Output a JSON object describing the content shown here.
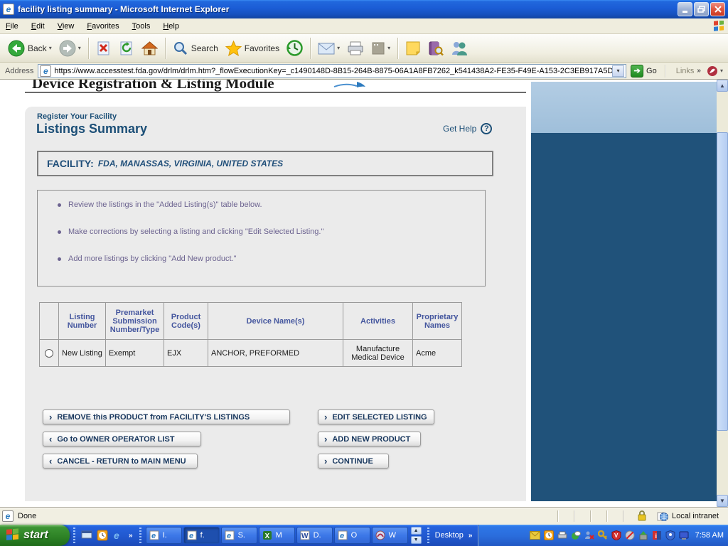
{
  "window": {
    "title": "facility listing summary - Microsoft Internet Explorer"
  },
  "menu": {
    "items": [
      "File",
      "Edit",
      "View",
      "Favorites",
      "Tools",
      "Help"
    ]
  },
  "toolbar": {
    "back_label": "Back",
    "search_label": "Search",
    "favorites_label": "Favorites"
  },
  "address": {
    "label": "Address",
    "url": "https://www.accesstest.fda.gov/drlm/drlm.htm?_flowExecutionKey=_c1490148D-8B15-264B-8875-06A1A8FB7262_k541438A2-FE35-F49E-A153-2C3EB917A5D",
    "go_label": "Go",
    "links_label": "Links"
  },
  "page": {
    "app_header": "Device Registration & Listing Module",
    "breadcrumb": "Register Your Facility",
    "title": "Listings Summary",
    "get_help": "Get Help",
    "facility_label": "FACILITY:",
    "facility_value": "FDA, MANASSAS, VIRGINIA, UNITED STATES",
    "instructions": [
      "Review the listings in the \"Added Listing(s)\" table below.",
      "Make corrections by selecting a listing and clicking \"Edit Selected Listing.\"",
      "Add more listings by clicking \"Add New product.\""
    ],
    "table": {
      "headers": [
        "Listing Number",
        "Premarket Submission Number/Type",
        "Product Code(s)",
        "Device Name(s)",
        "Activities",
        "Proprietary Names"
      ],
      "rows": [
        {
          "listing_number": "New Listing",
          "premarket": "Exempt",
          "product_code": "EJX",
          "device_names": "ANCHOR, PREFORMED",
          "activities": "Manufacture Medical Device",
          "proprietary": "Acme"
        }
      ]
    },
    "buttons": {
      "remove": "REMOVE this PRODUCT from FACILITY'S LISTINGS",
      "edit": "EDIT SELECTED LISTING",
      "owner": "Go to OWNER OPERATOR LIST",
      "add": "ADD NEW PRODUCT",
      "cancel": "CANCEL - RETURN to MAIN MENU",
      "continue": "CONTINUE"
    }
  },
  "status": {
    "text": "Done",
    "zone": "Local intranet"
  },
  "taskbar": {
    "start_label": "start",
    "tasks": [
      {
        "label": "I."
      },
      {
        "label": "f."
      },
      {
        "label": "S."
      },
      {
        "label": "M"
      },
      {
        "label": "D."
      },
      {
        "label": "O"
      },
      {
        "label": "W"
      }
    ],
    "desktop_label": "Desktop",
    "clock": "7:58 AM"
  },
  "colors": {
    "title_blue": "#1c4f77",
    "facility_navy": "#1f4e79",
    "instruction_purple": "#6c6390",
    "table_header_blue": "#44569e",
    "band_dark": "#20527a",
    "band_light": "#a9c7e1"
  }
}
